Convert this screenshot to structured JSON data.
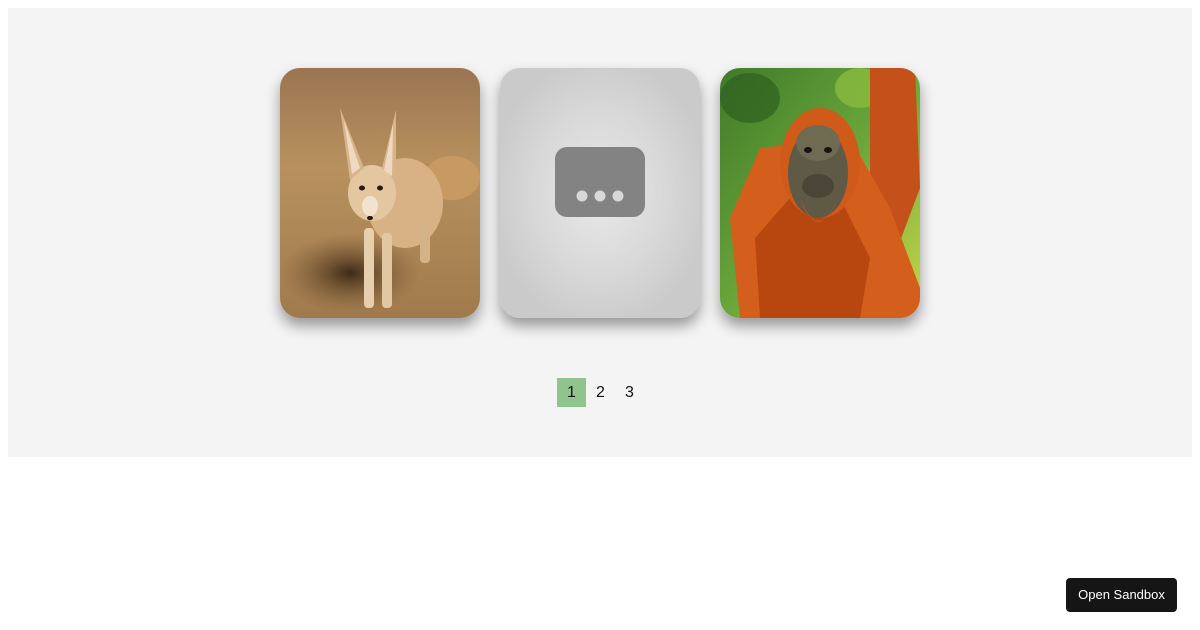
{
  "carousel": {
    "cards": [
      {
        "name": "fox-image",
        "alt": "fennec fox"
      },
      {
        "name": "loading-placeholder",
        "alt": "loading"
      },
      {
        "name": "orangutan-image",
        "alt": "orangutan"
      }
    ]
  },
  "pagination": {
    "pages": [
      "1",
      "2",
      "3"
    ],
    "active_page": "1",
    "active_color": "#8fc48c"
  },
  "sandbox_button": {
    "label": "Open Sandbox"
  },
  "colors": {
    "stage_background": "#f4f4f4",
    "button_background": "#151515"
  }
}
